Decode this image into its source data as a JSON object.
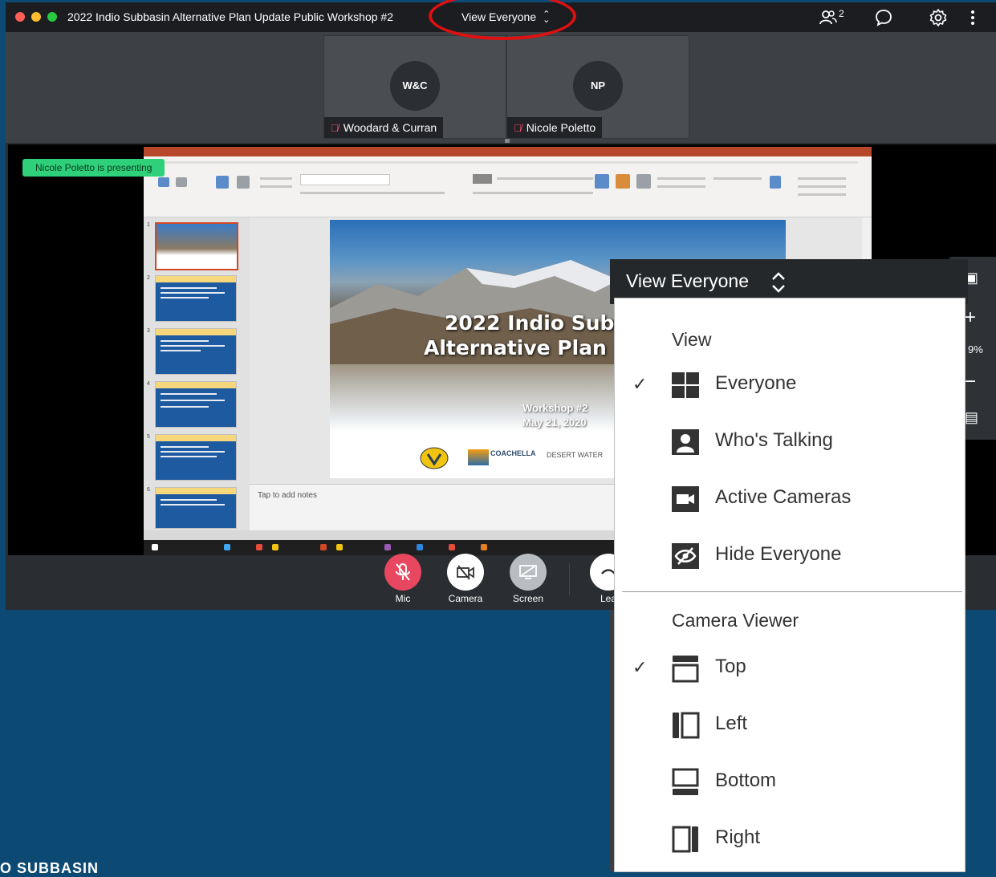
{
  "window": {
    "title": "2022 Indio Subbasin Alternative Plan Update Public Workshop #2",
    "view_selector_label": "View Everyone",
    "participants_count": "2"
  },
  "participants": [
    {
      "initials": "W&C",
      "name": "Woodard & Curran",
      "muted": true
    },
    {
      "initials": "NP",
      "name": "Nicole Poletto",
      "muted": true
    }
  ],
  "presenting_badge": "Nicole Poletto is presenting",
  "slide": {
    "title_line1": "2022 Indio Sub",
    "title_line2": "Alternative Plan",
    "sub_line1": "Workshop #2",
    "sub_line2": "May 21, 2020",
    "logo_coachella": "COACHELLA",
    "logo_desert_water": "DESERT WATER",
    "notes_placeholder": "Tap to add notes"
  },
  "thumbnail_numbers": [
    "1",
    "2",
    "3",
    "4",
    "5",
    "6"
  ],
  "controls": {
    "mic": "Mic",
    "camera": "Camera",
    "screen": "Screen",
    "leave": "Lea"
  },
  "side_panel": {
    "zoom": "9%"
  },
  "background_text": "O SUBBASIN",
  "dropdown": {
    "header": "View Everyone",
    "view_section": "View",
    "view_items": [
      {
        "label": "Everyone",
        "checked": true,
        "icon": "grid-icon"
      },
      {
        "label": "Who's Talking",
        "checked": false,
        "icon": "person-icon"
      },
      {
        "label": "Active Cameras",
        "checked": false,
        "icon": "video-camera-icon"
      },
      {
        "label": "Hide Everyone",
        "checked": false,
        "icon": "eye-slash-icon"
      }
    ],
    "camera_section": "Camera Viewer",
    "camera_items": [
      {
        "label": "Top",
        "checked": true,
        "icon": "layout-top-icon"
      },
      {
        "label": "Left",
        "checked": false,
        "icon": "layout-left-icon"
      },
      {
        "label": "Bottom",
        "checked": false,
        "icon": "layout-bottom-icon"
      },
      {
        "label": "Right",
        "checked": false,
        "icon": "layout-right-icon"
      }
    ]
  },
  "colors": {
    "mic_muted": "#e8485f",
    "presenting_green": "#2fd07a",
    "highlight_red": "#e01010",
    "background_blue": "#0d4a73"
  }
}
